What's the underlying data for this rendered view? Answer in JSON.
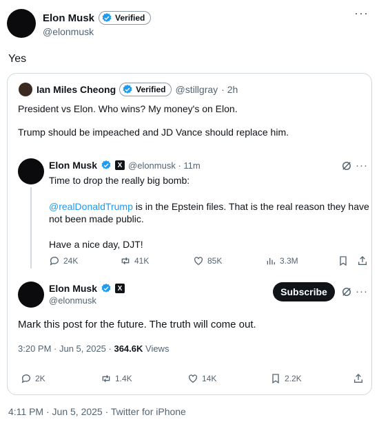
{
  "main_tweet": {
    "name": "Elon Musk",
    "verified_label": "Verified",
    "handle": "@elonmusk",
    "text": "Yes",
    "footer": "4:11 PM · Jun 5, 2025 · Twitter for iPhone"
  },
  "quoted": {
    "name": "Ian Miles Cheong",
    "verified_label": "Verified",
    "handle": "@stillgray",
    "time": "· 2h",
    "line1": "President vs Elon. Who wins? My money's on Elon.",
    "line2": "Trump should be impeached and JD Vance should replace him."
  },
  "nested": {
    "name": "Elon Musk",
    "x_label": "X",
    "handle_time": "@elonmusk · 11m",
    "line1": "Time to drop the really big bomb:",
    "mention": "@realDonaldTrump",
    "line2_rest": " is in the Epstein files. That is the real reason they have",
    "line3": "not been made public.",
    "line4": "Have a nice day, DJT!",
    "actions": {
      "replies": "24K",
      "reposts": "41K",
      "likes": "85K",
      "views": "3.3M"
    }
  },
  "reply": {
    "name": "Elon Musk",
    "x_label": "X",
    "handle": "@elonmusk",
    "subscribe_label": "Subscribe",
    "text": "Mark this post for the future. The truth will come out.",
    "time": "3:20 PM · Jun 5, 2025 · ",
    "views_count": "364.6K",
    "views_label": " Views",
    "actions": {
      "replies": "2K",
      "reposts": "1.4K",
      "likes": "14K",
      "bookmarks": "2.2K"
    }
  },
  "colors": {
    "accent": "#1d9bf0",
    "text": "#0f1419",
    "muted": "#536471",
    "border": "#cfd9de"
  },
  "icons": {
    "menu": "more-icon",
    "verified": "verified-badge-icon",
    "reply": "reply-icon",
    "repost": "repost-icon",
    "like": "like-icon",
    "views": "views-icon",
    "bookmark": "bookmark-icon",
    "share": "share-icon",
    "grok": "grok-icon"
  }
}
